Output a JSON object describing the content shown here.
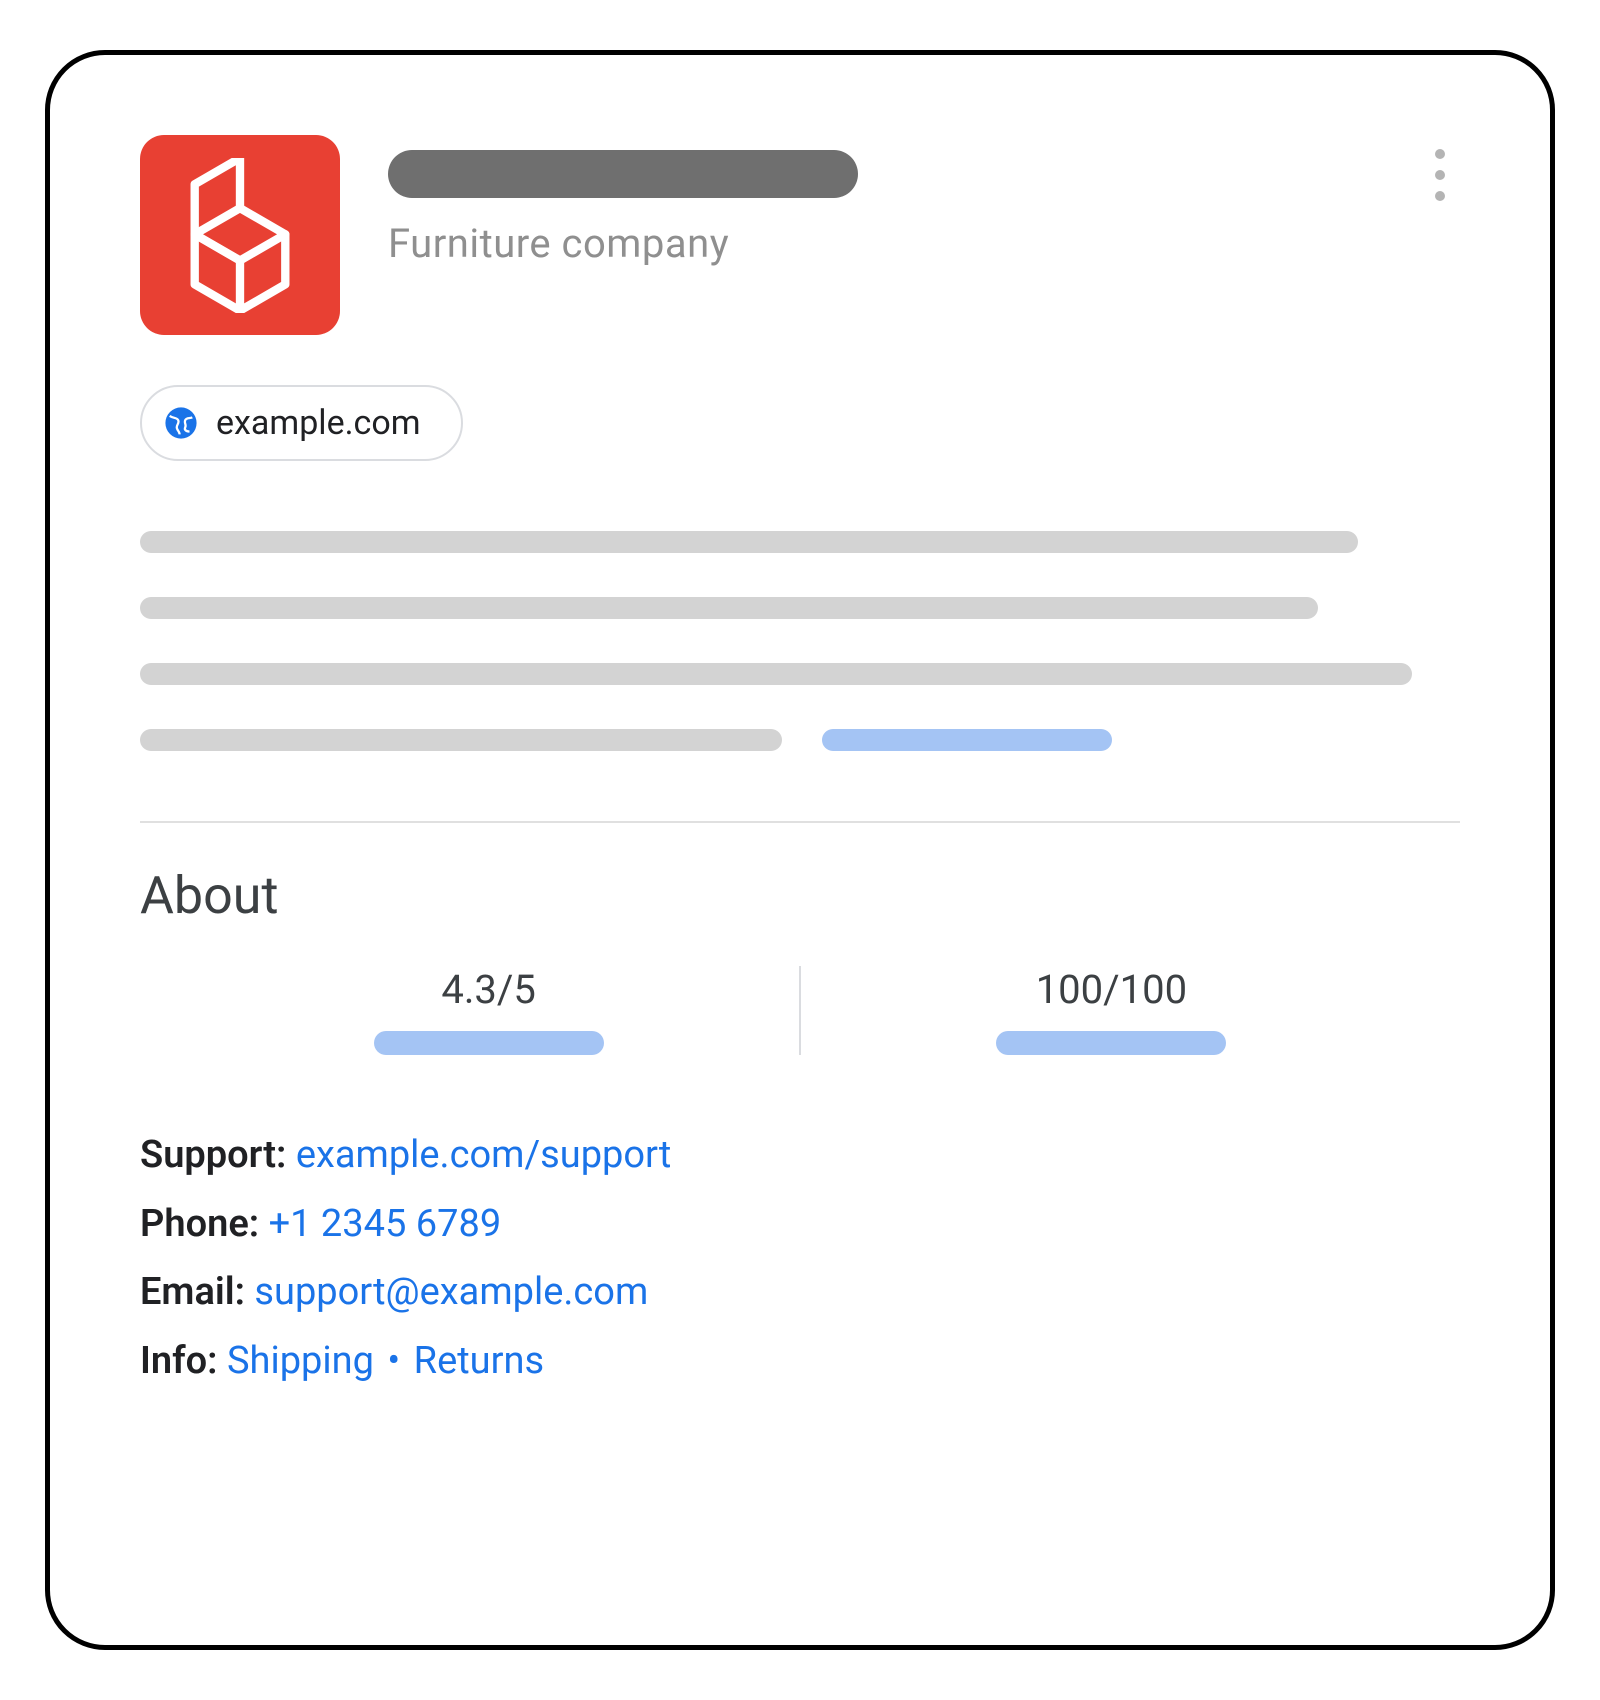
{
  "header": {
    "subtitle": "Furniture company",
    "logo_bg": "#E84033"
  },
  "website": {
    "label": "example.com"
  },
  "about": {
    "heading": "About",
    "rating": "4.3/5",
    "score": "100/100"
  },
  "contact": {
    "support_label": "Support:",
    "support_value": "example.com/support",
    "phone_label": "Phone:",
    "phone_value": "+1 2345 6789",
    "email_label": "Email:",
    "email_value": "support@example.com",
    "info_label": "Info:",
    "info_shipping": "Shipping",
    "info_separator": "•",
    "info_returns": "Returns"
  }
}
